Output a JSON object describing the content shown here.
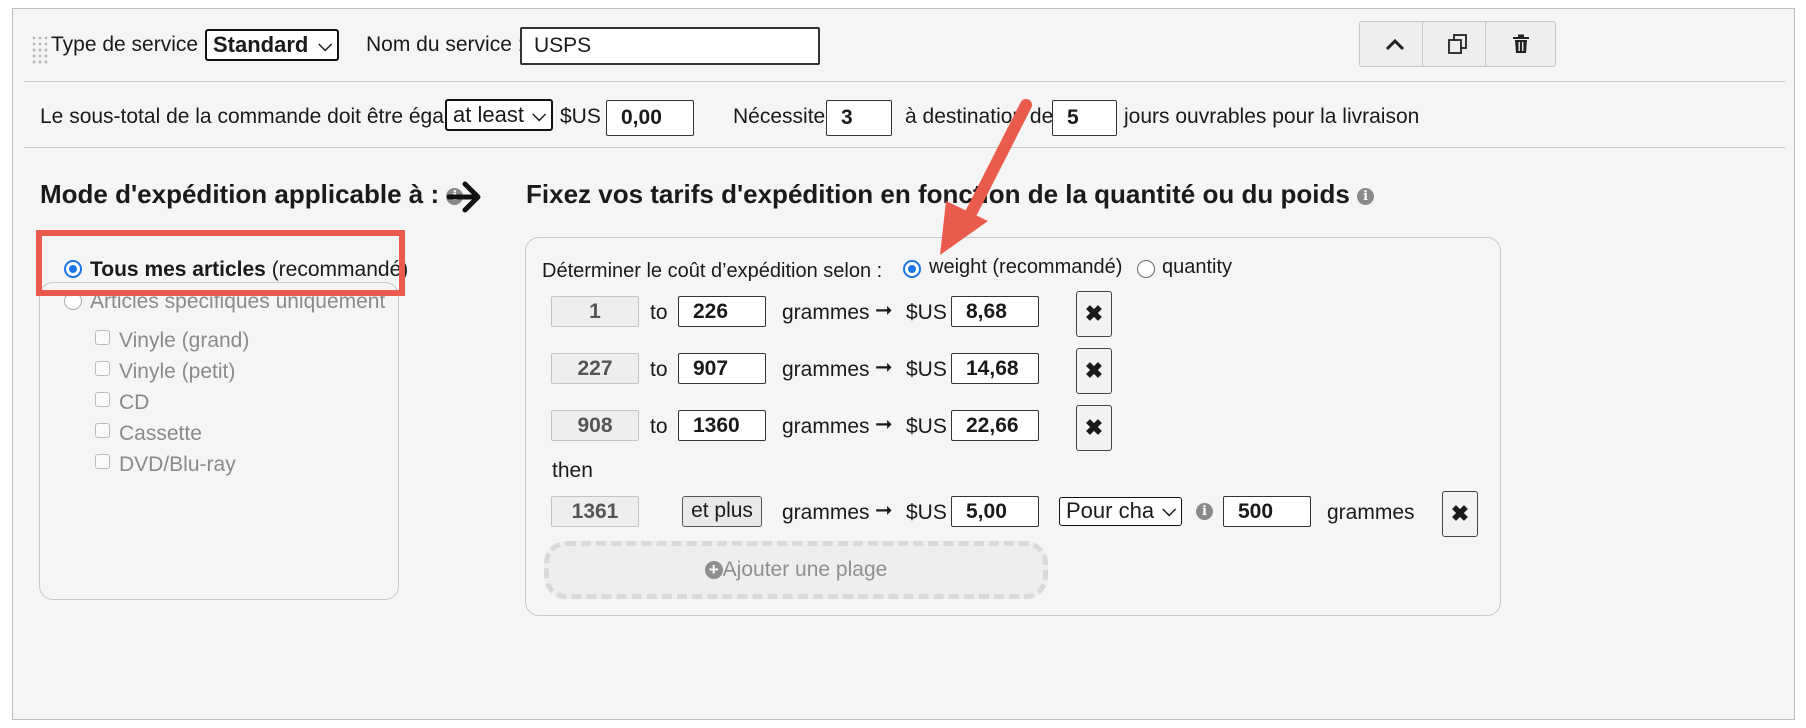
{
  "header": {
    "service_type_label": "Type de service :",
    "service_type_value": "Standard",
    "service_name_label": "Nom du service :",
    "service_name_value": "USPS",
    "buttons": {
      "up_icon": "chevron-up-icon",
      "copy_icon": "copy-icon",
      "delete_icon": "trash-icon"
    }
  },
  "conditions": {
    "subtotal_label": "Le sous-total de la commande doit être égal à",
    "subtotal_operator": "at least",
    "currency": "$US",
    "subtotal_value": "0,00",
    "requires_label": "Nécessite",
    "min_days": "3",
    "to_dest_label": "à destination de",
    "max_days": "5",
    "days_label": "jours ouvrables pour la livraison"
  },
  "applies_to": {
    "heading": "Mode d'expédition applicable à :",
    "options": [
      {
        "label_bold": "Tous mes articles",
        "label_suffix": " (recommandé)",
        "selected": true
      },
      {
        "label": "Articles spécifiques uniquement",
        "selected": false
      }
    ],
    "categories": [
      "Vinyle (grand)",
      "Vinyle (petit)",
      "CD",
      "Cassette",
      "DVD/Blu-ray"
    ]
  },
  "rates": {
    "heading": "Fixez vos tarifs d'expédition en fonction de la quantité ou du poids",
    "basis_label": "Déterminer le coût d’expédition selon :",
    "basis_options": [
      {
        "label": "weight (recommandé)",
        "selected": true
      },
      {
        "label": "quantity",
        "selected": false
      }
    ],
    "to_label": "to",
    "unit": "grammes",
    "arrow": "➞",
    "currency": "$US",
    "rows": [
      {
        "from": "1",
        "to": "226",
        "price": "8,68"
      },
      {
        "from": "227",
        "to": "907",
        "price": "14,68"
      },
      {
        "from": "908",
        "to": "1360",
        "price": "22,66"
      }
    ],
    "then_label": "then",
    "last_row": {
      "from": "1361",
      "and_more": "et plus",
      "price": "5,00",
      "per_select": "Pour cha",
      "per_value": "500",
      "unit": "grammes"
    },
    "delete_glyph": "✖",
    "add_range": "Ajouter une plage"
  },
  "colors": {
    "annotation_red": "#ea5b4d",
    "radio_blue": "#1a73e8"
  }
}
